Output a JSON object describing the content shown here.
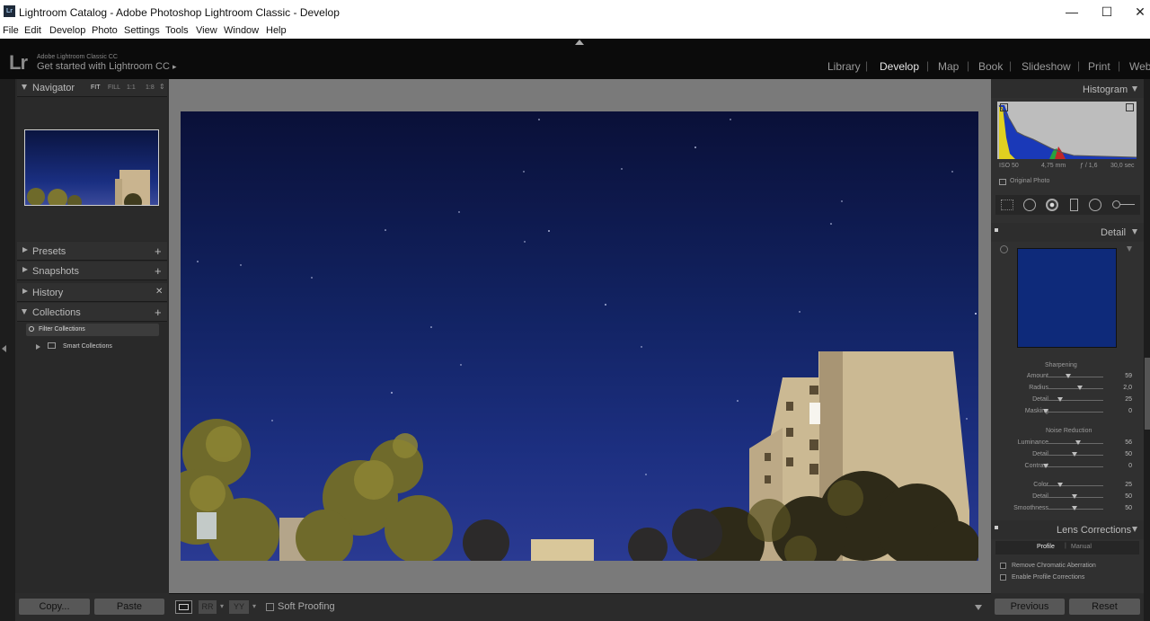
{
  "window": {
    "title": "Lightroom Catalog - Adobe Photoshop Lightroom Classic - Develop",
    "app_icon": "Lr",
    "minimize": "—",
    "maximize": "☐",
    "close": "✕"
  },
  "menu": [
    "File",
    "Edit",
    "Develop",
    "Photo",
    "Settings",
    "Tools",
    "View",
    "Window",
    "Help"
  ],
  "identity": {
    "logo": "Lr",
    "product": "Adobe Lightroom Classic CC",
    "tagline": "Get started with Lightroom CC",
    "tagline_arrow": "▸"
  },
  "modules": [
    "Library",
    "Develop",
    "Map",
    "Book",
    "Slideshow",
    "Print",
    "Web"
  ],
  "active_module": "Develop",
  "left": {
    "navigator": {
      "title": "Navigator",
      "zoom": [
        "FIT",
        "FILL",
        "1:1",
        "1:8"
      ],
      "zoom_arrows": "⇕"
    },
    "panels": [
      {
        "label": "Presets",
        "action": "+"
      },
      {
        "label": "Snapshots",
        "action": "+"
      },
      {
        "label": "History",
        "action": "✕"
      },
      {
        "label": "Collections",
        "action": "+"
      }
    ],
    "collections": {
      "filter": "Filter Collections",
      "smart": "Smart Collections"
    },
    "copy": "Copy...",
    "paste": "Paste"
  },
  "toolbar": {
    "soft_proofing": "Soft Proofing",
    "rr": "RR",
    "yy": "YY"
  },
  "right": {
    "histogram": {
      "title": "Histogram",
      "iso": "ISO 50",
      "focal": "4,75 mm",
      "aperture": "ƒ / 1,6",
      "shutter": "30,0 sec",
      "original": "Original Photo"
    },
    "detail": {
      "title": "Detail",
      "sharpening": "Sharpening",
      "sharp_rows": [
        {
          "label": "Amount",
          "value": "59",
          "pos": 0.39
        },
        {
          "label": "Radius",
          "value": "2,0",
          "pos": 0.59
        },
        {
          "label": "Detail",
          "value": "25",
          "pos": 0.25
        },
        {
          "label": "Masking",
          "value": "0",
          "pos": 0.0
        }
      ],
      "noise": "Noise Reduction",
      "noise_rows": [
        {
          "label": "Luminance",
          "value": "56",
          "pos": 0.56
        },
        {
          "label": "Detail",
          "value": "50",
          "pos": 0.5
        },
        {
          "label": "Contrast",
          "value": "0",
          "pos": 0.0
        },
        {
          "label": "Color",
          "value": "25",
          "pos": 0.25
        },
        {
          "label": "Detail",
          "value": "50",
          "pos": 0.5
        },
        {
          "label": "Smoothness",
          "value": "50",
          "pos": 0.5
        }
      ]
    },
    "lens": {
      "title": "Lens Corrections",
      "tab_profile": "Profile",
      "tab_manual": "Manual",
      "remove_ca": "Remove Chromatic Aberration",
      "enable_profile": "Enable Profile Corrections"
    },
    "previous": "Previous",
    "reset": "Reset"
  }
}
